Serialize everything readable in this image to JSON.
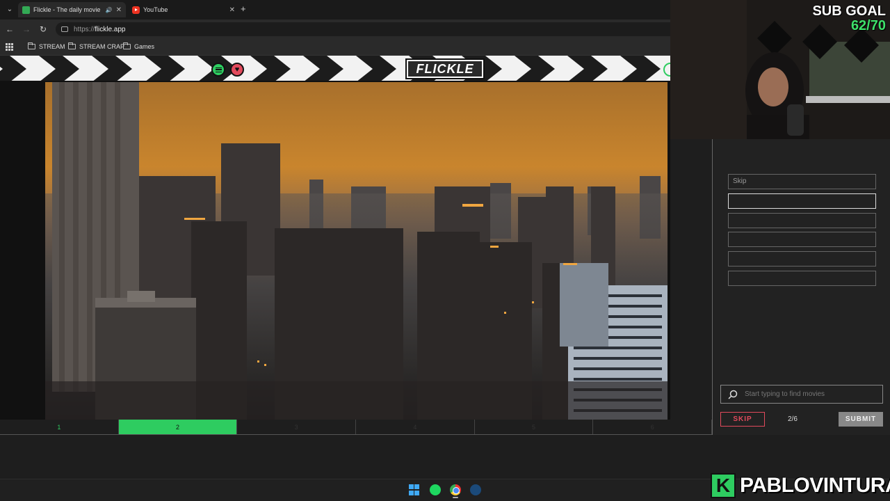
{
  "browser": {
    "tabs": [
      {
        "title": "Flickle - The daily movie gu",
        "active": true
      },
      {
        "title": "YouTube",
        "active": false
      }
    ],
    "url_scheme": "https://",
    "url_host": "flickle.app",
    "bookmarks": [
      "STREAM",
      "STREAM CRAP",
      "Games"
    ]
  },
  "app": {
    "logo": "FLICKLE",
    "guesses": [
      {
        "text": "Skip"
      },
      {
        "text": ""
      },
      {
        "text": ""
      },
      {
        "text": ""
      },
      {
        "text": ""
      },
      {
        "text": ""
      }
    ],
    "progress": [
      "1",
      "2",
      "3",
      "4",
      "5",
      "6"
    ],
    "current_frame": 2,
    "search_placeholder": "Start typing to find movies",
    "skip_label": "SKIP",
    "counter": "2/6",
    "submit_label": "SUBMIT"
  },
  "overlay": {
    "sub_goal_label": "SUB GOAL",
    "sub_goal_count": "62/70",
    "brand_letter": "K",
    "brand_name": "PABLOVINTURA"
  },
  "colors": {
    "accent_green": "#2ecc60",
    "skip_red": "#e24a5c"
  }
}
